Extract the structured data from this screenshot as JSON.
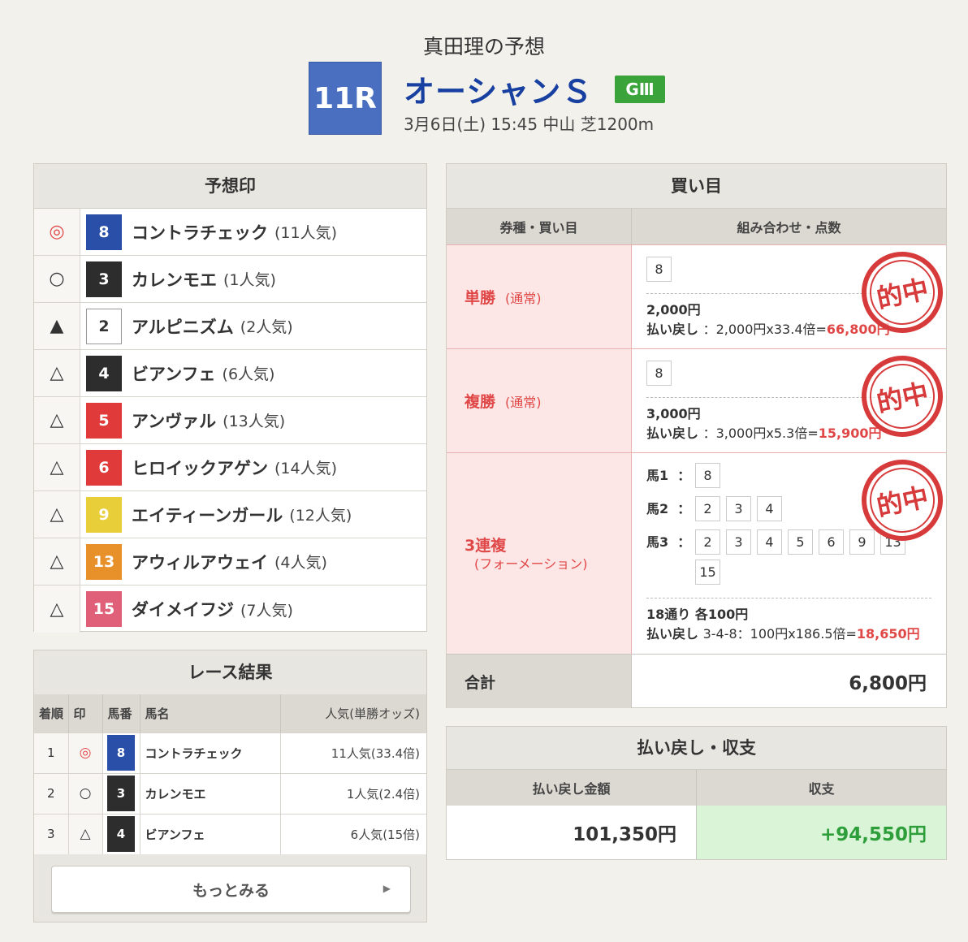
{
  "header": {
    "author": "真田理の予想",
    "race_no": "11R",
    "race_name": "オーシャンＳ",
    "grade": "GⅢ",
    "race_info": "3月6日(土) 15:45 中山 芝1200m"
  },
  "predictions": {
    "title": "予想印",
    "rows": [
      {
        "mark": "◎",
        "num": "8",
        "color": "#2a4fa8",
        "name": "コントラチェック",
        "pop": "(11人気)"
      },
      {
        "mark": "○",
        "num": "3",
        "color": "#2d2d2d",
        "name": "カレンモエ",
        "pop": "(1人気)"
      },
      {
        "mark": "▲",
        "num": "2",
        "color": "#ffffff",
        "name": "アルピニズム",
        "pop": "(2人気)"
      },
      {
        "mark": "△",
        "num": "4",
        "color": "#2d2d2d",
        "name": "ビアンフェ",
        "pop": "(6人気)"
      },
      {
        "mark": "△",
        "num": "5",
        "color": "#e03a3a",
        "name": "アンヴァル",
        "pop": "(13人気)"
      },
      {
        "mark": "△",
        "num": "6",
        "color": "#e03a3a",
        "name": "ヒロイックアゲン",
        "pop": "(14人気)"
      },
      {
        "mark": "△",
        "num": "9",
        "color": "#e8cf3a",
        "name": "エイティーンガール",
        "pop": "(12人気)"
      },
      {
        "mark": "△",
        "num": "13",
        "color": "#e8902a",
        "name": "アウィルアウェイ",
        "pop": "(4人気)"
      },
      {
        "mark": "△",
        "num": "15",
        "color": "#e0607a",
        "name": "ダイメイフジ",
        "pop": "(7人気)"
      }
    ]
  },
  "results": {
    "title": "レース結果",
    "headers": [
      "着順",
      "印",
      "馬番",
      "馬名",
      "人気(単勝オッズ)"
    ],
    "rows": [
      {
        "rank": "1",
        "mark": "◎",
        "num": "8",
        "color": "#2a4fa8",
        "name": "コントラチェック",
        "pop": "11人気(33.4倍)"
      },
      {
        "rank": "2",
        "mark": "○",
        "num": "3",
        "color": "#2d2d2d",
        "name": "カレンモエ",
        "pop": "1人気(2.4倍)"
      },
      {
        "rank": "3",
        "mark": "△",
        "num": "4",
        "color": "#2d2d2d",
        "name": "ビアンフェ",
        "pop": "6人気(15倍)"
      }
    ],
    "more_label": "もっとみる"
  },
  "bets": {
    "title": "買い目",
    "col1": "券種・買い目",
    "col2": "組み合わせ・点数",
    "stamp": "的中",
    "win": {
      "type": "単勝",
      "note": "(通常)",
      "box": "8",
      "amount": "2,000円",
      "payout_label": "払い戻し",
      "payout_calc": "：2,000円x33.4倍=",
      "payout_value": "66,800円"
    },
    "place": {
      "type": "複勝",
      "note": "(通常)",
      "box": "8",
      "amount": "3,000円",
      "payout_label": "払い戻し",
      "payout_calc": "：3,000円x5.3倍=",
      "payout_value": "15,900円"
    },
    "trio": {
      "type": "3連複",
      "note": "(フォーメーション)",
      "horse1_label": "馬1",
      "horse2_label": "馬2",
      "horse3_label": "馬3",
      "colon": "：",
      "horse1": [
        "8"
      ],
      "horse2": [
        "2",
        "3",
        "4"
      ],
      "horse3": [
        "2",
        "3",
        "4",
        "5",
        "6",
        "9",
        "13",
        "15"
      ],
      "amount": "18通り 各100円",
      "payout_label": "払い戻し",
      "payout_calc": "3-4-8：100円x186.5倍=",
      "payout_value": "18,650円"
    },
    "total_label": "合計",
    "total_value": "6,800円"
  },
  "summary": {
    "title": "払い戻し・収支",
    "col1": "払い戻し金額",
    "col2": "収支",
    "payout": "101,350円",
    "balance": "+94,550円"
  }
}
